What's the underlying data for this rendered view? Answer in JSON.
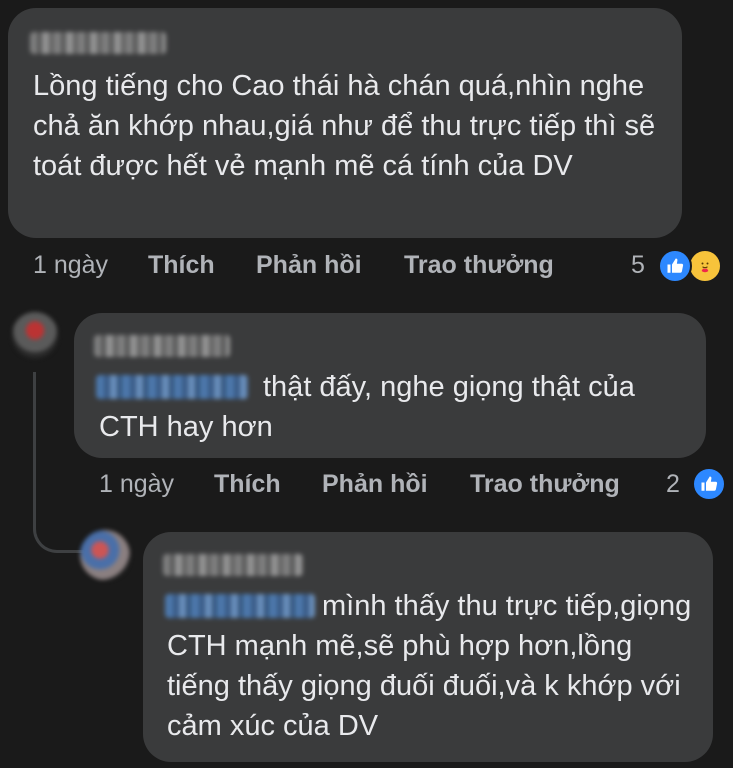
{
  "comments": [
    {
      "text": "Lồng tiếng cho Cao thái hà chán quá,nhìn nghe chả ăn khớp nhau,giá như để thu trực tiếp thì sẽ toát được hết vẻ mạnh mẽ cá tính của DV",
      "time": "1 ngày",
      "like": "Thích",
      "reply": "Phản hồi",
      "award": "Trao thưởng",
      "reaction_count": "5",
      "reactions": [
        "like-icon",
        "care-icon"
      ]
    },
    {
      "text": "thật đấy, nghe giọng thật của CTH hay hơn",
      "time": "1 ngày",
      "like": "Thích",
      "reply": "Phản hồi",
      "award": "Trao thưởng",
      "reaction_count": "2",
      "reactions": [
        "like-icon"
      ]
    },
    {
      "text": "mình thấy thu trực tiếp,giọng CTH mạnh mẽ,sẽ phù hợp hơn,lồng tiếng thấy giọng đuối đuối,và k khớp với cảm xúc của DV"
    }
  ],
  "colors": {
    "background": "#1a1a1a",
    "bubble": "#3a3b3c",
    "like_blue": "#2d88ff",
    "muted_text": "#b0b3b8"
  }
}
